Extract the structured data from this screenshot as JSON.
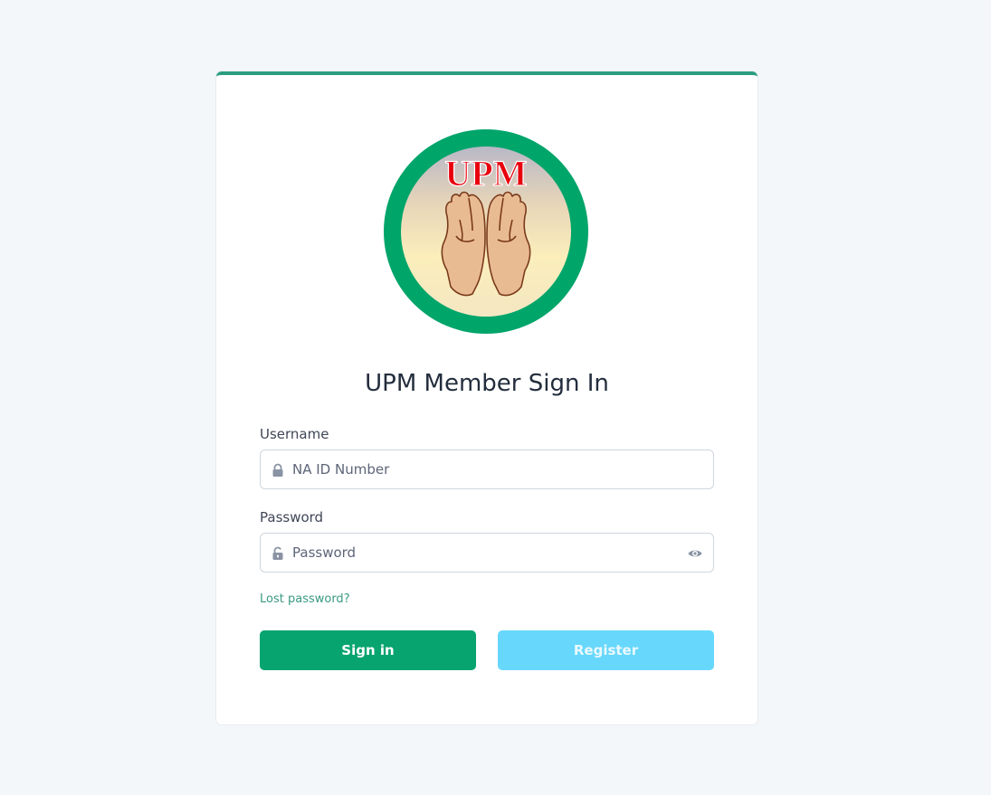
{
  "logo": {
    "text": "UPM",
    "ring_color": "#00a56a",
    "text_color": "#e8000d"
  },
  "form": {
    "title": "UPM Member Sign In",
    "username": {
      "label": "Username",
      "placeholder": "NA ID Number",
      "icon": "lock-icon"
    },
    "password": {
      "label": "Password",
      "placeholder": "Password",
      "icon": "unlock-icon",
      "toggle_icon": "eye-icon"
    },
    "lost_password": "Lost password?",
    "signin_label": "Sign in",
    "register_label": "Register"
  },
  "colors": {
    "accent": "#2a9d80",
    "primary_button": "#07a470",
    "secondary_button": "#67d8fb",
    "background": "#f4f7fa"
  }
}
